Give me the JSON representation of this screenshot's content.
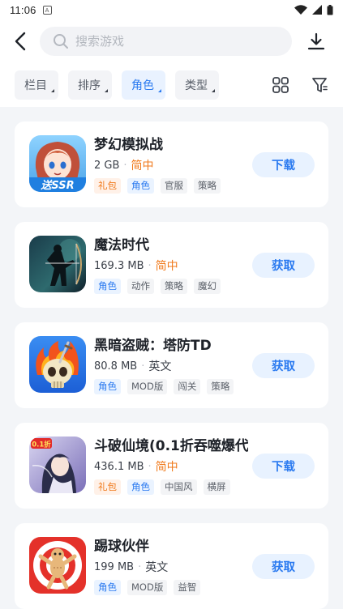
{
  "status_bar": {
    "time": "11:06"
  },
  "search": {
    "placeholder": "搜索游戏"
  },
  "filters": [
    {
      "label": "栏目"
    },
    {
      "label": "排序"
    },
    {
      "label": "角色",
      "active": true
    },
    {
      "label": "类型"
    }
  ],
  "games": [
    {
      "name": "梦幻模拟战",
      "size": "2 GB",
      "language": "简中",
      "tags": [
        "礼包",
        "角色",
        "官服",
        "策略"
      ],
      "action": "下载",
      "icon": "anime-girl-portrait-icon",
      "icon_text": "送SSR"
    },
    {
      "name": "魔法时代",
      "size": "169.3 MB",
      "language": "简中",
      "tags": [
        "角色",
        "动作",
        "策略",
        "魔幻"
      ],
      "action": "获取",
      "icon": "archer-silhouette-icon"
    },
    {
      "name": "黑暗盗贼：塔防TD",
      "size": "80.8 MB",
      "language": "英文",
      "tags": [
        "角色",
        "MOD版",
        "闯关",
        "策略"
      ],
      "action": "获取",
      "icon": "flaming-skull-icon"
    },
    {
      "name": "斗破仙境(0.1折吞噬爆代",
      "size": "436.1 MB",
      "language": "简中",
      "tags": [
        "礼包",
        "角色",
        "中国风",
        "横屏"
      ],
      "action": "下载",
      "icon": "fantasy-heroine-icon",
      "icon_text": "0.1折"
    },
    {
      "name": "踢球伙伴",
      "size": "199 MB",
      "language": "英文",
      "tags": [
        "角色",
        "MOD版",
        "益智"
      ],
      "action": "获取",
      "icon": "ragdoll-target-icon"
    }
  ],
  "colors": {
    "accent": "#2a7af0",
    "orange": "#f07a1c",
    "background": "#f3f5f8"
  }
}
